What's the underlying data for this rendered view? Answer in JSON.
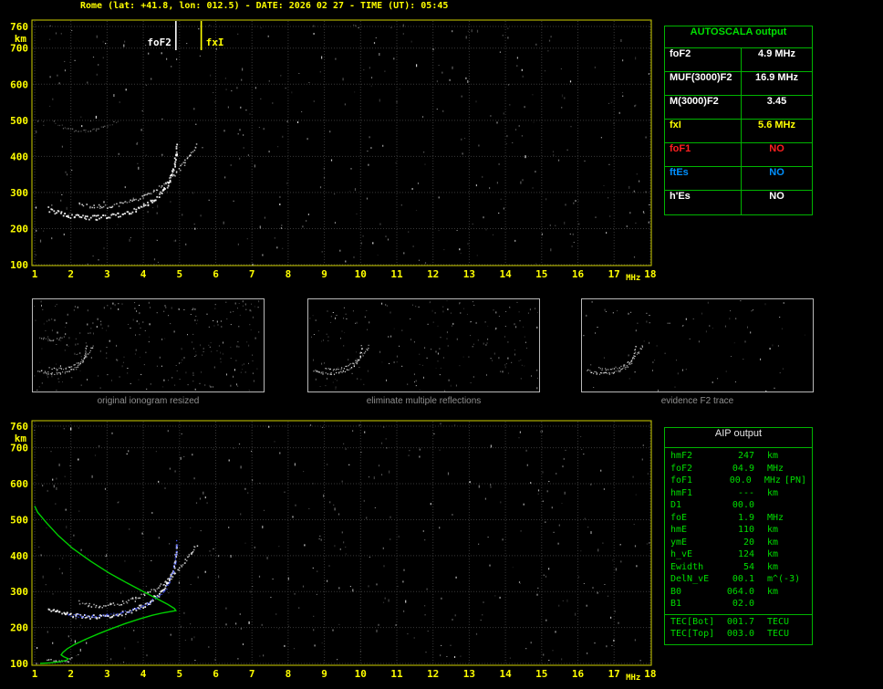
{
  "header": {
    "title": "Rome (lat: +41.8, lon: 012.5) - DATE: 2026 02 27 - TIME (UT): 05:45"
  },
  "autoscala_table": {
    "title": "AUTOSCALA output",
    "rows": [
      {
        "label": "foF2",
        "value": "4.9 MHz",
        "color": "#ffffff"
      },
      {
        "label": "MUF(3000)F2",
        "value": "16.9 MHz",
        "color": "#ffffff"
      },
      {
        "label": "M(3000)F2",
        "value": "3.45",
        "color": "#ffffff"
      },
      {
        "label": "fxI",
        "value": "5.6 MHz",
        "color": "#ffff00"
      },
      {
        "label": "foF1",
        "value": "NO",
        "color": "#ff2020"
      },
      {
        "label": "ftEs",
        "value": "NO",
        "color": "#0090ff"
      },
      {
        "label": "h'Es",
        "value": "NO",
        "color": "#ffffff"
      }
    ]
  },
  "aip_table": {
    "title": "AIP output",
    "rows": [
      {
        "label": "hmF2",
        "value": "247",
        "unit": "km"
      },
      {
        "label": "foF2",
        "value": "04.9",
        "unit": "MHz"
      },
      {
        "label": "foF1",
        "value": "00.0",
        "unit": "MHz",
        "flag": "[PN]"
      },
      {
        "label": "hmF1",
        "value": "---",
        "unit": "km"
      },
      {
        "label": "D1",
        "value": "00.0",
        "unit": ""
      },
      {
        "label": "foE",
        "value": "1.9",
        "unit": "MHz"
      },
      {
        "label": "hmE",
        "value": "110",
        "unit": "km"
      },
      {
        "label": "ymE",
        "value": "20",
        "unit": "km"
      },
      {
        "label": "h_vE",
        "value": "124",
        "unit": "km"
      },
      {
        "label": "Ewidth",
        "value": "54",
        "unit": "km"
      },
      {
        "label": "DelN_vE",
        "value": "00.1",
        "unit": "m^(-3)"
      },
      {
        "label": "B0",
        "value": "064.0",
        "unit": "km"
      },
      {
        "label": "B1",
        "value": "02.0",
        "unit": ""
      }
    ],
    "tec_rows": [
      {
        "label": "TEC[Bot]",
        "value": "001.7",
        "unit": "TECU"
      },
      {
        "label": "TEC[Top]",
        "value": "003.0",
        "unit": "TECU"
      }
    ]
  },
  "thumbnails": [
    {
      "caption": "original ionogram resized",
      "series_names": [
        "o-trace",
        "x-trace",
        "second-hop-trace"
      ],
      "noise_dots": 270
    },
    {
      "caption": "eliminate multiple reflections",
      "series_names": [
        "o-trace",
        "x-trace"
      ],
      "noise_dots": 200
    },
    {
      "caption": "evidence F2 trace",
      "series_names": [
        "o-trace",
        "x-trace"
      ],
      "noise_dots": 80
    }
  ],
  "chart_data": [
    {
      "type": "scatter",
      "name": "autoscaled-ionogram",
      "title": "ionogram with AUTOSCALA frequency markers",
      "xlabel": "MHz",
      "ylabel": "km",
      "xlim": [
        1,
        18
      ],
      "ylim": [
        100,
        760
      ],
      "x_ticks": [
        1,
        2,
        3,
        4,
        5,
        6,
        7,
        8,
        9,
        10,
        11,
        12,
        13,
        14,
        15,
        16,
        17,
        18
      ],
      "y_ticks": [
        760,
        700,
        600,
        500,
        400,
        300,
        200,
        100
      ],
      "grid": true,
      "markers": [
        {
          "label": "foF2",
          "x": 4.9,
          "color": "#ffffff",
          "label_side": "left"
        },
        {
          "label": "fxI",
          "x": 5.6,
          "color": "#ffff00",
          "label_side": "right"
        }
      ],
      "series": [
        {
          "name": "o-trace",
          "color": "#ffffff",
          "dot": 1.8,
          "thickness": 5,
          "step": 1.8,
          "min_opacity": 0.75,
          "points": [
            [
              1.35,
              256
            ],
            [
              1.6,
              246
            ],
            [
              1.85,
              239
            ],
            [
              2.1,
              235
            ],
            [
              2.4,
              232
            ],
            [
              2.7,
              232
            ],
            [
              3.0,
              235
            ],
            [
              3.3,
              240
            ],
            [
              3.6,
              248
            ],
            [
              3.85,
              257
            ],
            [
              4.1,
              269
            ],
            [
              4.3,
              284
            ],
            [
              4.5,
              302
            ],
            [
              4.65,
              323
            ],
            [
              4.76,
              348
            ],
            [
              4.84,
              376
            ],
            [
              4.89,
              405
            ],
            [
              4.91,
              432
            ]
          ]
        },
        {
          "name": "x-trace",
          "color": "#e8e8e8",
          "dot": 1.5,
          "thickness": 4,
          "step": 2.0,
          "min_opacity": 0.55,
          "points": [
            [
              2.2,
              271
            ],
            [
              2.5,
              264
            ],
            [
              2.8,
              262
            ],
            [
              3.1,
              264
            ],
            [
              3.4,
              270
            ],
            [
              3.7,
              279
            ],
            [
              4.0,
              291
            ],
            [
              4.3,
              307
            ],
            [
              4.6,
              327
            ],
            [
              4.85,
              352
            ],
            [
              5.1,
              380
            ],
            [
              5.3,
              408
            ],
            [
              5.45,
              432
            ]
          ]
        },
        {
          "name": "second-hop-trace",
          "color": "#9a9a9a",
          "dot": 1.2,
          "thickness": 3,
          "step": 2.6,
          "min_opacity": 0.3,
          "points": [
            [
              1.5,
              496
            ],
            [
              1.8,
              482
            ],
            [
              2.1,
              474
            ],
            [
              2.4,
              472
            ],
            [
              2.7,
              476
            ],
            [
              3.0,
              486
            ],
            [
              3.3,
              500
            ]
          ]
        }
      ]
    },
    {
      "type": "scatter",
      "name": "ionogram-with-profile",
      "title": "ionogram with restored trace and electron density profile",
      "xlabel": "MHz",
      "ylabel": "km",
      "xlim": [
        1,
        18
      ],
      "ylim": [
        100,
        760
      ],
      "x_ticks": [
        1,
        2,
        3,
        4,
        5,
        6,
        7,
        8,
        9,
        10,
        11,
        12,
        13,
        14,
        15,
        16,
        17,
        18
      ],
      "y_ticks": [
        760,
        700,
        600,
        500,
        400,
        300,
        200,
        100
      ],
      "grid": true,
      "markers": [],
      "series": [
        {
          "name": "e-trace",
          "color": "#dddddd",
          "dot": 1.4,
          "thickness": 3,
          "step": 2.2,
          "min_opacity": 0.6,
          "points": [
            [
              1.35,
              113
            ],
            [
              1.55,
              109
            ],
            [
              1.75,
              107
            ],
            [
              1.9,
              109
            ],
            [
              2.0,
              114
            ]
          ]
        },
        {
          "name": "o-trace",
          "color": "#ffffff",
          "dot": 1.8,
          "thickness": 5,
          "step": 1.8,
          "min_opacity": 0.75,
          "points": [
            [
              1.35,
              256
            ],
            [
              1.6,
              246
            ],
            [
              1.85,
              239
            ],
            [
              2.1,
              235
            ],
            [
              2.4,
              232
            ],
            [
              2.7,
              232
            ],
            [
              3.0,
              235
            ],
            [
              3.3,
              240
            ],
            [
              3.6,
              248
            ],
            [
              3.85,
              257
            ],
            [
              4.1,
              269
            ],
            [
              4.3,
              284
            ],
            [
              4.5,
              302
            ],
            [
              4.65,
              323
            ],
            [
              4.76,
              348
            ],
            [
              4.84,
              376
            ],
            [
              4.89,
              405
            ],
            [
              4.91,
              432
            ]
          ]
        },
        {
          "name": "x-trace",
          "color": "#e8e8e8",
          "dot": 1.5,
          "thickness": 4,
          "step": 2.0,
          "min_opacity": 0.55,
          "points": [
            [
              2.2,
              271
            ],
            [
              2.5,
              264
            ],
            [
              2.8,
              262
            ],
            [
              3.1,
              264
            ],
            [
              3.4,
              270
            ],
            [
              3.7,
              279
            ],
            [
              4.0,
              291
            ],
            [
              4.3,
              307
            ],
            [
              4.6,
              327
            ],
            [
              4.85,
              352
            ],
            [
              5.1,
              380
            ],
            [
              5.3,
              408
            ],
            [
              5.45,
              432
            ]
          ]
        },
        {
          "name": "restored-trace",
          "color": "#4455ff",
          "dot": 1.3,
          "thickness": 3,
          "step": 2.0,
          "min_opacity": 0.7,
          "points": [
            [
              1.9,
              238
            ],
            [
              2.2,
              234
            ],
            [
              2.6,
              232
            ],
            [
              3.0,
              235
            ],
            [
              3.4,
              242
            ],
            [
              3.8,
              252
            ],
            [
              4.1,
              266
            ],
            [
              4.35,
              283
            ],
            [
              4.55,
              303
            ],
            [
              4.7,
              326
            ],
            [
              4.8,
              352
            ],
            [
              4.87,
              383
            ],
            [
              4.9,
              415
            ],
            [
              4.91,
              440
            ]
          ]
        },
        {
          "name": "electron-density-profile",
          "color": "#00d000",
          "line": true,
          "points": [
            [
              1.15,
              100
            ],
            [
              1.45,
              102
            ],
            [
              1.7,
              105
            ],
            [
              1.88,
              109
            ],
            [
              1.93,
              113
            ],
            [
              1.8,
              119
            ],
            [
              1.73,
              124
            ],
            [
              1.78,
              131
            ],
            [
              1.9,
              141
            ],
            [
              2.1,
              153
            ],
            [
              2.4,
              167
            ],
            [
              2.75,
              182
            ],
            [
              3.1,
              196
            ],
            [
              3.5,
              211
            ],
            [
              3.9,
              224
            ],
            [
              4.25,
              234
            ],
            [
              4.55,
              241
            ],
            [
              4.78,
              245
            ],
            [
              4.9,
              247
            ],
            [
              4.86,
              253
            ],
            [
              4.68,
              264
            ],
            [
              4.38,
              280
            ],
            [
              4.0,
              300
            ],
            [
              3.55,
              324
            ],
            [
              3.05,
              352
            ],
            [
              2.55,
              384
            ],
            [
              2.05,
              420
            ],
            [
              1.65,
              456
            ],
            [
              1.32,
              492
            ],
            [
              1.08,
              521
            ],
            [
              1.0,
              538
            ]
          ]
        }
      ]
    }
  ]
}
